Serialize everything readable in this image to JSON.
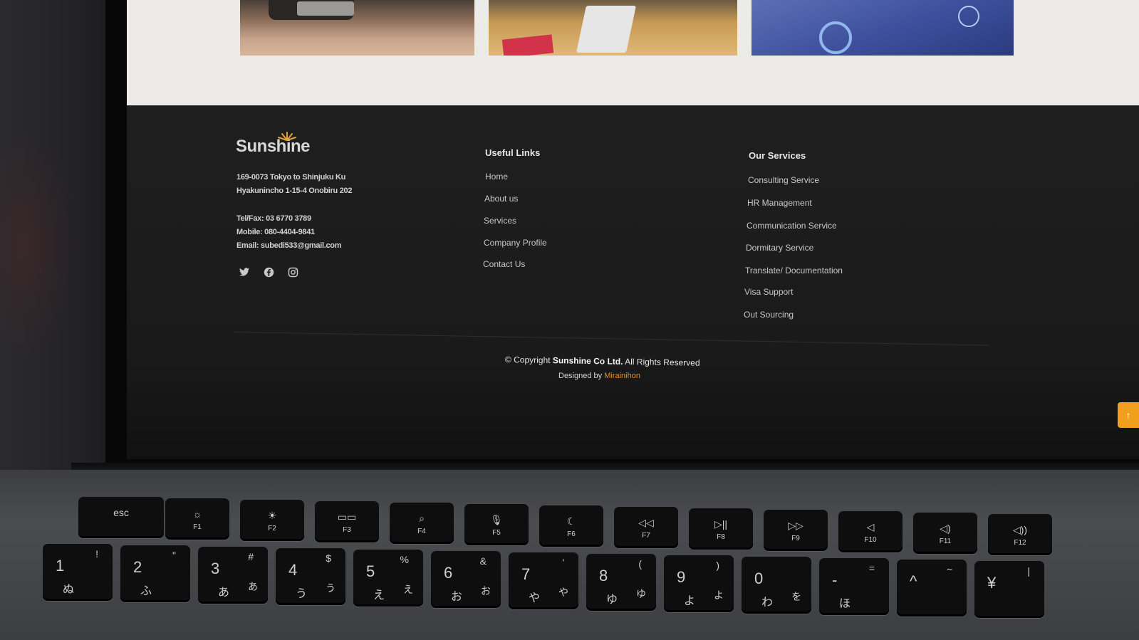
{
  "footer": {
    "logo_text": "Sunshine",
    "address_line1": "169-0073 Tokyo to Shinjuku Ku",
    "address_line2": "Hyakunincho 1-15-4 Onobiru 202",
    "tel": "Tel/Fax: 03 6770 3789",
    "mobile": "Mobile: 080-4404-9841",
    "email": "Email: subedi533@gmail.com",
    "social_icons": [
      "twitter-icon",
      "facebook-icon",
      "instagram-icon"
    ],
    "useful_links": {
      "title": "Useful Links",
      "items": [
        "Home",
        "About us",
        "Services",
        "Company Profile",
        "Contact Us"
      ]
    },
    "our_services": {
      "title": "Our Services",
      "items": [
        "Consulting Service",
        "HR Management",
        "Communication Service",
        "Dormitary Service",
        "Translate/ Documentation",
        "Visa Support",
        "Out Sourcing"
      ]
    },
    "copyright_prefix": "© Copyright",
    "copyright_company": "Sunshine Co Ltd.",
    "copyright_suffix": "All Rights Reserved",
    "designed_by_prefix": "Designed by",
    "designed_by_name": "Mirainihon",
    "accent_color": "#f08a1c",
    "back_to_top_icon": "arrow-up-icon"
  },
  "keyboard": {
    "function_row": [
      {
        "top": "esc",
        "bottom": ""
      },
      {
        "top": "☼",
        "bottom": "F1"
      },
      {
        "top": "☀",
        "bottom": "F2"
      },
      {
        "top": "▭▭",
        "bottom": "F3"
      },
      {
        "top": "⌕",
        "bottom": "F4"
      },
      {
        "top": "🎙",
        "bottom": "F5"
      },
      {
        "top": "☾",
        "bottom": "F6"
      },
      {
        "top": "◁◁",
        "bottom": "F7"
      },
      {
        "top": "▷||",
        "bottom": "F8"
      },
      {
        "top": "▷▷",
        "bottom": "F9"
      },
      {
        "top": "◁",
        "bottom": "F10"
      },
      {
        "top": "◁)",
        "bottom": "F11"
      },
      {
        "top": "◁))",
        "bottom": "F12"
      }
    ],
    "number_row": [
      {
        "num": "1",
        "sym": "!",
        "kana": "",
        "kana2": "ぬ"
      },
      {
        "num": "2",
        "sym": "\"",
        "kana": "",
        "kana2": "ふ"
      },
      {
        "num": "3",
        "sym": "#",
        "kana": "あ",
        "kana2": "あ"
      },
      {
        "num": "4",
        "sym": "$",
        "kana": "う",
        "kana2": "う"
      },
      {
        "num": "5",
        "sym": "%",
        "kana": "え",
        "kana2": "え"
      },
      {
        "num": "6",
        "sym": "&",
        "kana": "お",
        "kana2": "お"
      },
      {
        "num": "7",
        "sym": "'",
        "kana": "や",
        "kana2": "や"
      },
      {
        "num": "8",
        "sym": "(",
        "kana": "ゆ",
        "kana2": "ゆ"
      },
      {
        "num": "9",
        "sym": ")",
        "kana": "よ",
        "kana2": "よ"
      },
      {
        "num": "0",
        "sym": "",
        "kana": "を",
        "kana2": "わ"
      },
      {
        "num": "-",
        "sym": "=",
        "kana": "",
        "kana2": "ほ"
      },
      {
        "num": "^",
        "sym": "~",
        "kana": "",
        "kana2": ""
      },
      {
        "num": "¥",
        "sym": "|",
        "kana": "",
        "kana2": ""
      }
    ]
  }
}
